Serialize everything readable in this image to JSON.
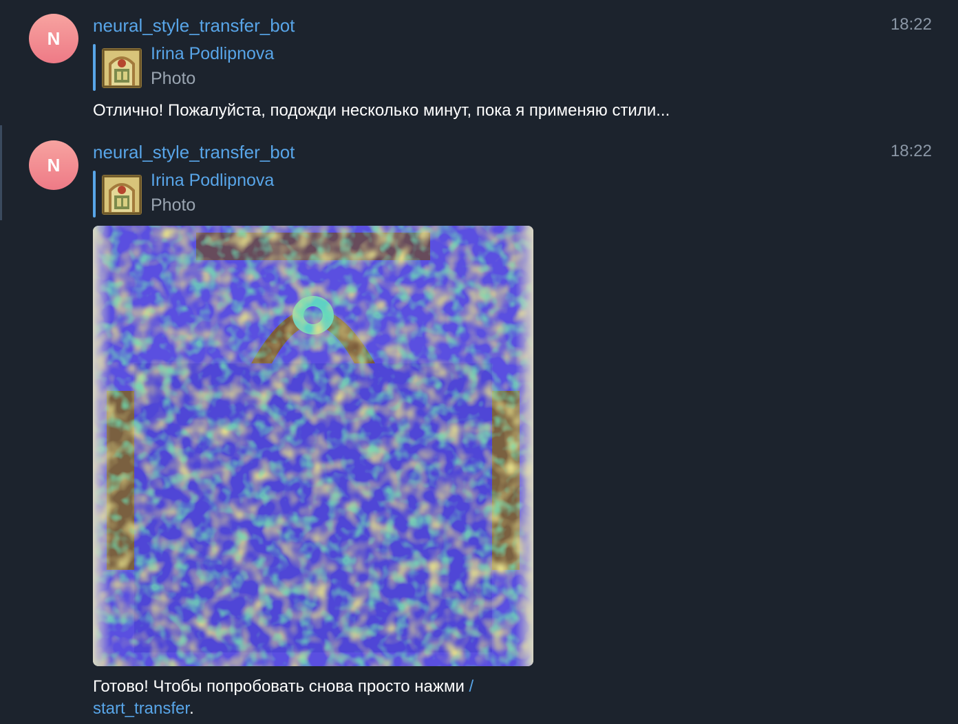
{
  "messages": [
    {
      "avatar_letter": "N",
      "sender": "neural_style_transfer_bot",
      "time": "18:22",
      "reply": {
        "name": "Irina Podlipnova",
        "type": "Photo"
      },
      "text": "Отлично! Пожалуйста, подожди несколько минут, пока я применяю стили..."
    },
    {
      "avatar_letter": "N",
      "sender": "neural_style_transfer_bot",
      "time": "18:22",
      "reply": {
        "name": "Irina Podlipnova",
        "type": "Photo"
      },
      "caption_prefix": "Готово! Чтобы попробовать снова просто нажми ",
      "caption_link_1": "/",
      "caption_link_2": "start_transfer",
      "caption_suffix": "."
    }
  ],
  "colors": {
    "background": "#1c232d",
    "link": "#58a5e8",
    "avatar_gradient_top": "#f7a3a0",
    "avatar_gradient_bottom": "#ee7a86",
    "secondary_text": "#9aa5b1",
    "timestamp": "#8b97a6"
  },
  "icons": {
    "reply_thumbnail": "stained-glass-thumbnail",
    "result_image": "stylized-stained-glass-image"
  }
}
